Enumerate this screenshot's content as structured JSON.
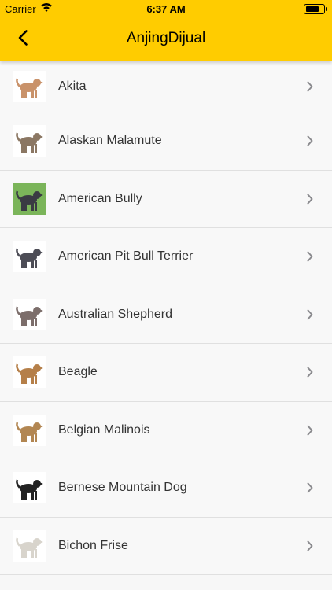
{
  "status_bar": {
    "carrier": "Carrier",
    "time": "6:37 AM"
  },
  "nav": {
    "title": "AnjingDijual",
    "back_icon": "chevron-left-icon"
  },
  "breeds": [
    {
      "name": "Akita",
      "color": "#c9926a"
    },
    {
      "name": "Alaskan Malamute",
      "color": "#8b7763"
    },
    {
      "name": "American Bully",
      "color": "#3a3b43"
    },
    {
      "name": "American Pit Bull Terrier",
      "color": "#4d4d56"
    },
    {
      "name": "Australian Shepherd",
      "color": "#7c6e6b"
    },
    {
      "name": "Beagle",
      "color": "#b57f49"
    },
    {
      "name": "Belgian Malinois",
      "color": "#b28652"
    },
    {
      "name": "Bernese Mountain Dog",
      "color": "#222222"
    },
    {
      "name": "Bichon Frise",
      "color": "#d8d4cc"
    }
  ],
  "colors": {
    "accent": "#ffcc00",
    "background": "#f8f8f8",
    "separator": "#e0e0e0"
  }
}
